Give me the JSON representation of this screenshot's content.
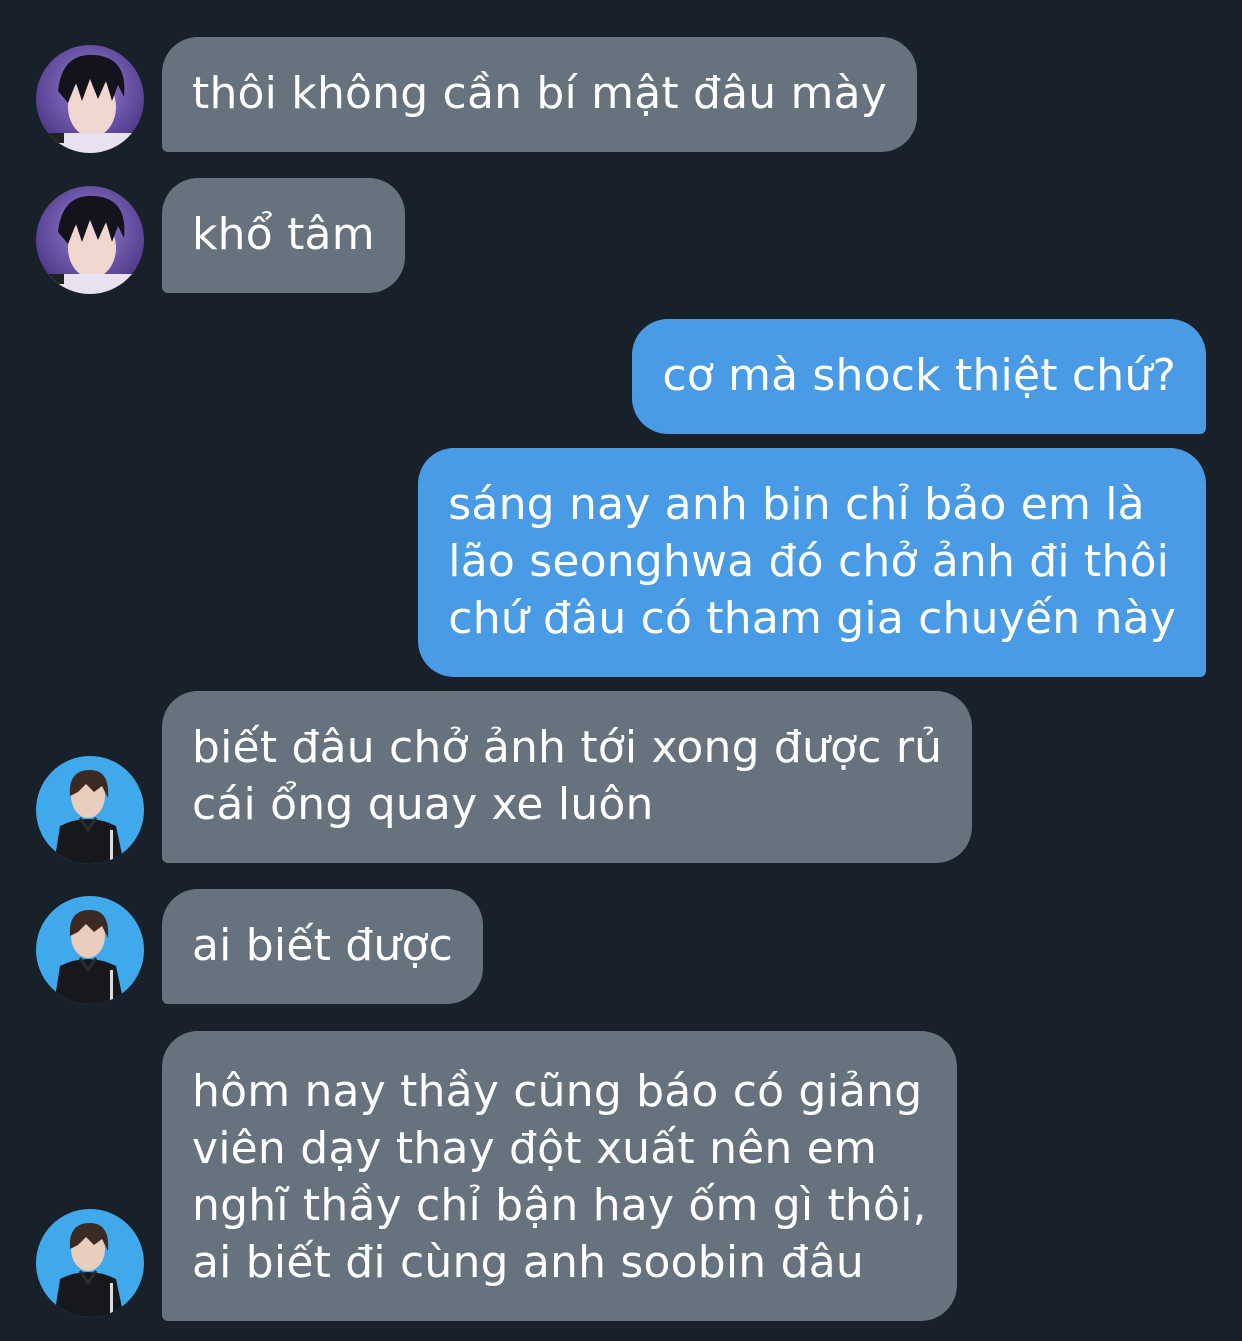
{
  "conversation": {
    "messages": [
      {
        "side": "incoming",
        "sender_avatar": "avatar-purple",
        "text": "thôi không cần bí mật đâu mày"
      },
      {
        "side": "incoming",
        "sender_avatar": "avatar-purple",
        "text": "khổ tâm"
      },
      {
        "side": "outgoing",
        "text": "cơ mà shock thiệt chứ?"
      },
      {
        "side": "outgoing",
        "text": "sáng nay anh bin chỉ bảo em là\nlão seonghwa đó chở ảnh đi thôi\nchứ đâu có tham gia chuyến này"
      },
      {
        "side": "incoming",
        "sender_avatar": "avatar-blue",
        "text": "biết đâu chở ảnh tới xong được rủ\ncái ổng quay xe luôn"
      },
      {
        "side": "incoming",
        "sender_avatar": "avatar-blue",
        "text": "ai biết được"
      },
      {
        "side": "incoming",
        "sender_avatar": "avatar-blue",
        "text": "hôm nay thầy cũng báo có giảng\nviên dạy thay đột xuất nên em\nnghĩ thầy chỉ bận hay ốm gì thôi,\nai biết đi cùng anh soobin đâu"
      }
    ]
  },
  "colors": {
    "background": "#18202a",
    "incoming_bubble": "#66727d",
    "outgoing_bubble": "#4a9be6",
    "text": "#ffffff",
    "avatar_purple_bg": "#6a4fa8",
    "avatar_blue_bg": "#3fa9ec"
  }
}
